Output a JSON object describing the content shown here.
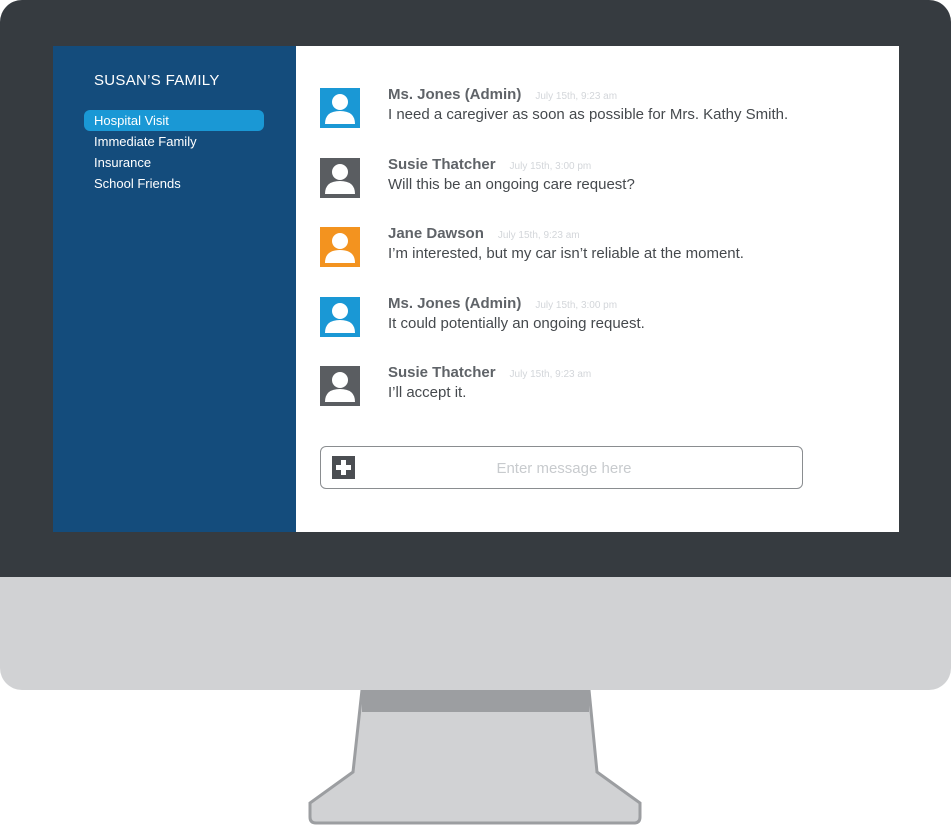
{
  "sidebar": {
    "group_title": "SUSAN’S FAMILY",
    "items": [
      {
        "label": "Hospital Visit",
        "active": true
      },
      {
        "label": "Immediate Family",
        "active": false
      },
      {
        "label": "Insurance",
        "active": false
      },
      {
        "label": "School Friends",
        "active": false
      }
    ]
  },
  "messages": [
    {
      "author": "Ms. Jones (Admin)",
      "time": "July 15th, 9:23 am",
      "text": "I need a caregiver as soon as possible for Mrs. Kathy Smith.",
      "avatar_color": "#1a98d5"
    },
    {
      "author": "Susie Thatcher",
      "time": "July 15th, 3:00 pm",
      "text": "Will this be an ongoing care request?",
      "avatar_color": "#5a5d61"
    },
    {
      "author": "Jane Dawson",
      "time": "July 15th, 9:23 am",
      "text": "I’m interested, but my car isn’t reliable at the moment.",
      "avatar_color": "#f3931f"
    },
    {
      "author": "Ms. Jones (Admin)",
      "time": "July 15th, 3:00 pm",
      "text": "It could potentially an ongoing request.",
      "avatar_color": "#1a98d5"
    },
    {
      "author": "Susie Thatcher",
      "time": "July 15th, 9:23 am",
      "text": "I’ll accept it.",
      "avatar_color": "#5a5d61"
    }
  ],
  "composer": {
    "placeholder": "Enter message here",
    "attach_icon": "plus-icon",
    "attach_color": "#4b4e52"
  },
  "colors": {
    "sidebar_bg": "#144c7c",
    "active_item": "#1a98d5",
    "bezel": "#363b40",
    "chin": "#d1d2d4"
  }
}
